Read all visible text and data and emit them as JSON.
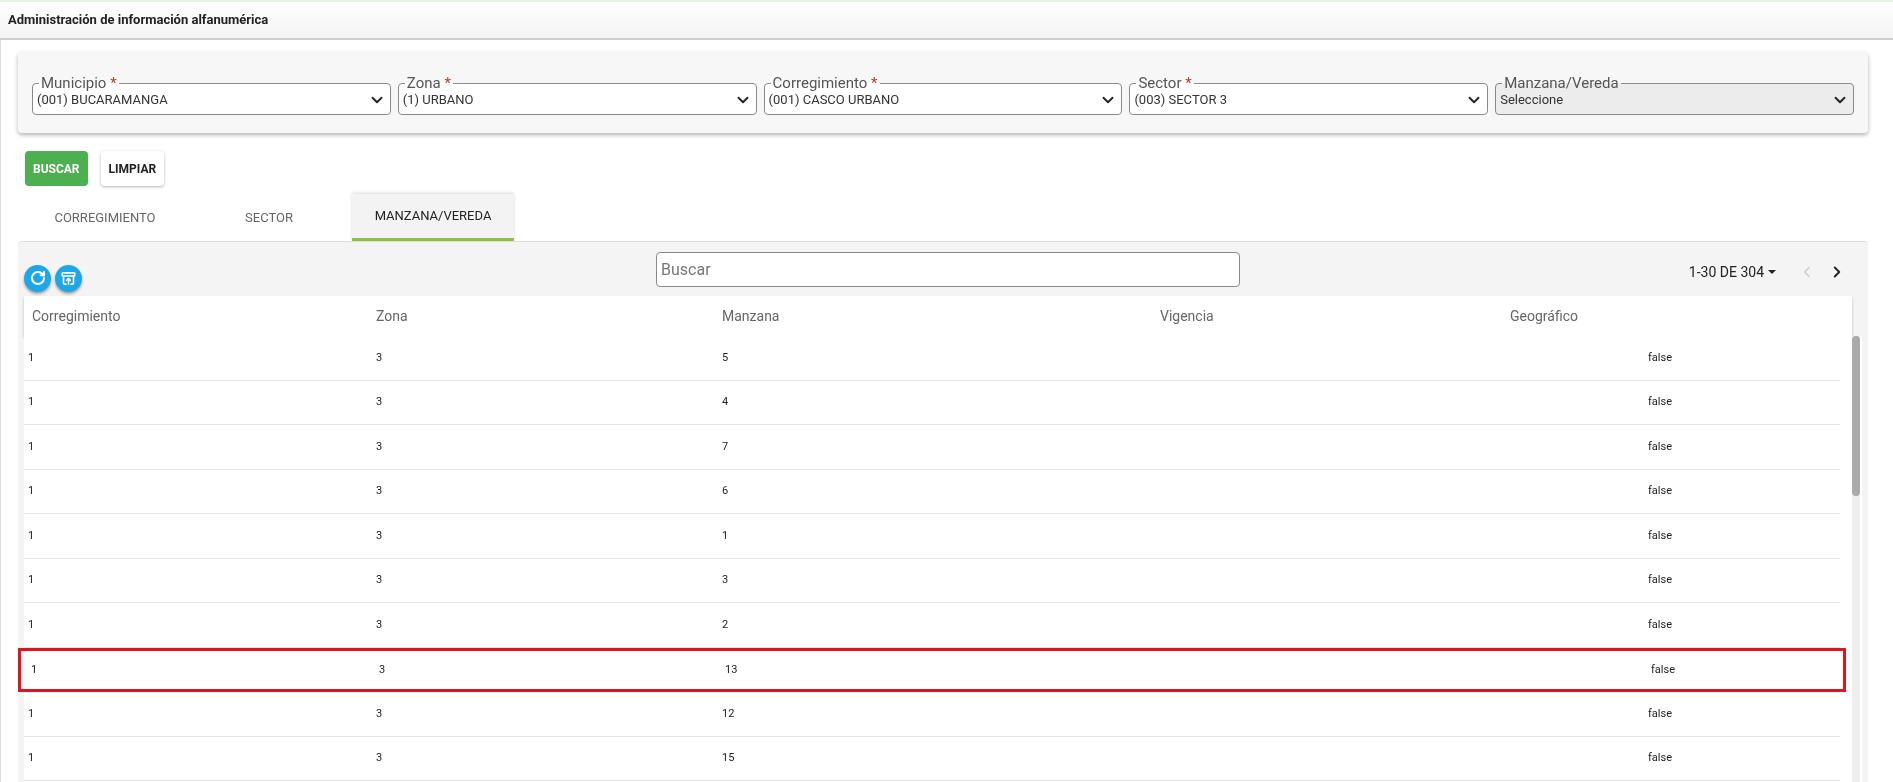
{
  "header": {
    "title": "Administración de información alfanumérica"
  },
  "filters": [
    {
      "label": "Municipio",
      "required": true,
      "value": "(001) BUCARAMANGA",
      "disabled": false
    },
    {
      "label": "Zona",
      "required": true,
      "value": "(1) URBANO",
      "disabled": false
    },
    {
      "label": "Corregimiento",
      "required": true,
      "value": "(001) CASCO URBANO",
      "disabled": false
    },
    {
      "label": "Sector",
      "required": true,
      "value": "(003) SECTOR 3",
      "disabled": false
    },
    {
      "label": "Manzana/Vereda",
      "required": false,
      "value": "Seleccione",
      "disabled": true
    }
  ],
  "required_mark": "*",
  "buttons": [
    {
      "label": "BUSCAR",
      "kind": "primary"
    },
    {
      "label": "LIMPIAR",
      "kind": "secondary"
    }
  ],
  "tabs": [
    {
      "label": "CORREGIMIENTO",
      "selected": false
    },
    {
      "label": "SECTOR",
      "selected": false
    },
    {
      "label": "MANZANA/VEREDA",
      "selected": true
    }
  ],
  "table": {
    "search": {
      "placeholder": "Buscar"
    },
    "pagination": "1-30 DE 304",
    "columns": [
      "Corregimiento",
      "Zona",
      "Manzana",
      "Vigencia",
      "Geográfico"
    ],
    "rows": [
      {
        "corregimiento": "1",
        "zona": "3",
        "manzana": "5",
        "geografico": "false",
        "highlighted": false
      },
      {
        "corregimiento": "1",
        "zona": "3",
        "manzana": "4",
        "geografico": "false",
        "highlighted": false
      },
      {
        "corregimiento": "1",
        "zona": "3",
        "manzana": "7",
        "geografico": "false",
        "highlighted": false
      },
      {
        "corregimiento": "1",
        "zona": "3",
        "manzana": "6",
        "geografico": "false",
        "highlighted": false
      },
      {
        "corregimiento": "1",
        "zona": "3",
        "manzana": "1",
        "geografico": "false",
        "highlighted": false
      },
      {
        "corregimiento": "1",
        "zona": "3",
        "manzana": "3",
        "geografico": "false",
        "highlighted": false
      },
      {
        "corregimiento": "1",
        "zona": "3",
        "manzana": "2",
        "geografico": "false",
        "highlighted": false
      },
      {
        "corregimiento": "1",
        "zona": "3",
        "manzana": "13",
        "geografico": "false",
        "highlighted": true
      },
      {
        "corregimiento": "1",
        "zona": "3",
        "manzana": "12",
        "geografico": "false",
        "highlighted": false
      },
      {
        "corregimiento": "1",
        "zona": "3",
        "manzana": "15",
        "geografico": "false",
        "highlighted": false
      }
    ]
  }
}
